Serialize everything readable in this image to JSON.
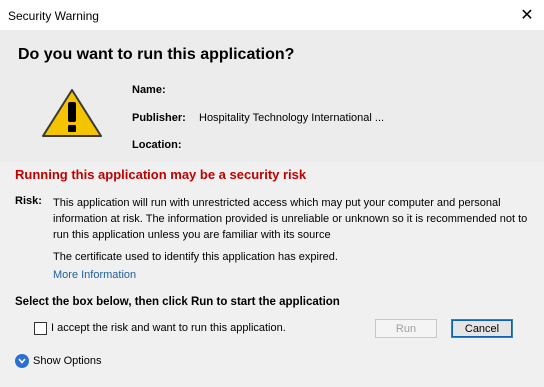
{
  "window": {
    "title": "Security Warning",
    "close_glyph": "✕"
  },
  "question": "Do you want to run this application?",
  "fields": {
    "name_label": "Name:",
    "name_value": "",
    "publisher_label": "Publisher:",
    "publisher_value": "Hospitality Technology International ...",
    "location_label": "Location:",
    "location_value": ""
  },
  "risk": {
    "title": "Running this application may be a security risk",
    "label": "Risk:",
    "text": "This application will run with unrestricted access which may put your computer and personal information at risk. The information provided is unreliable or unknown so it is recommended not to run this application unless you are familiar with its source",
    "certificate": "The certificate used to identify this application has expired.",
    "more_info": "More Information"
  },
  "instruction": "Select the box below, then click Run to start the application",
  "accept": {
    "label": "I accept the risk and want to run this application.",
    "checked": false
  },
  "buttons": {
    "run": "Run",
    "cancel": "Cancel"
  },
  "show_options": "Show Options",
  "colors": {
    "risk_title": "#c00000",
    "link": "#1f5f9f",
    "warning_fill": "#f5c400"
  },
  "icons": {
    "warning": "warning-triangle-icon",
    "close": "close-icon",
    "chevron": "chevron-down-icon"
  }
}
